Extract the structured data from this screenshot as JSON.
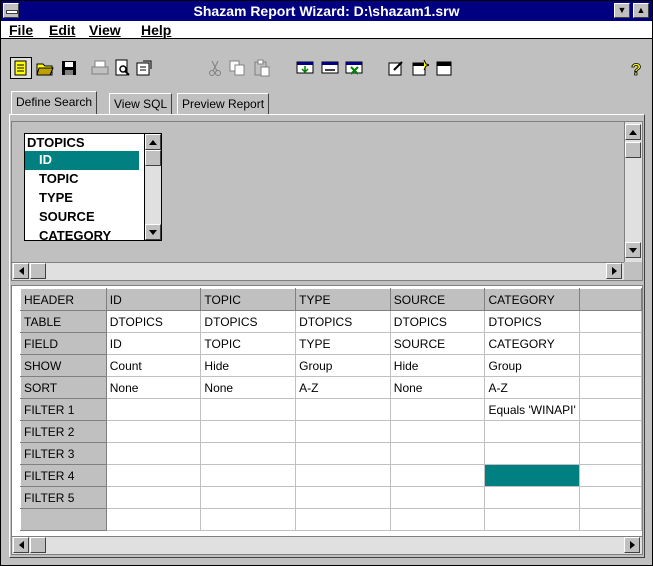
{
  "window": {
    "title": "Shazam Report Wizard: D:\\shazam1.srw"
  },
  "menu": [
    {
      "label": "File",
      "accel": "F"
    },
    {
      "label": "Edit",
      "accel": "E"
    },
    {
      "label": "View",
      "accel": "V"
    },
    {
      "label": "Help",
      "accel": "H"
    }
  ],
  "toolbar": {
    "icons": [
      "new-report-icon",
      "open-folder-icon",
      "save-icon",
      "print-icon",
      "print-preview-icon",
      "properties-icon",
      "cut-icon",
      "copy-icon",
      "paste-icon",
      "add-table-icon",
      "remove-table-icon",
      "delete-table-icon",
      "edit-icon",
      "insert-icon",
      "layout-icon",
      "help-icon"
    ]
  },
  "tabs": [
    {
      "label": "Define Search",
      "active": true
    },
    {
      "label": "View SQL",
      "active": false
    },
    {
      "label": "Preview Report",
      "active": false
    }
  ],
  "table_list": {
    "name": "DTOPICS",
    "fields": [
      "ID",
      "TOPIC",
      "TYPE",
      "SOURCE",
      "CATEGORY"
    ],
    "selected": "ID"
  },
  "grid": {
    "columns": [
      "HEADER",
      "ID",
      "TOPIC",
      "TYPE",
      "SOURCE",
      "CATEGORY",
      ""
    ],
    "rows": [
      {
        "label": "TABLE",
        "cells": [
          "DTOPICS",
          "DTOPICS",
          "DTOPICS",
          "DTOPICS",
          "DTOPICS",
          ""
        ]
      },
      {
        "label": "FIELD",
        "cells": [
          "ID",
          "TOPIC",
          "TYPE",
          "SOURCE",
          "CATEGORY",
          ""
        ]
      },
      {
        "label": "SHOW",
        "cells": [
          "Count",
          "Hide",
          "Group",
          "Hide",
          "Group",
          ""
        ]
      },
      {
        "label": "SORT",
        "cells": [
          "None",
          "None",
          "A-Z",
          "None",
          "A-Z",
          ""
        ]
      },
      {
        "label": "FILTER 1",
        "cells": [
          "",
          "",
          "",
          "",
          "Equals 'WINAPI'",
          ""
        ]
      },
      {
        "label": "FILTER 2",
        "cells": [
          "",
          "",
          "",
          "",
          "",
          ""
        ]
      },
      {
        "label": "FILTER 3",
        "cells": [
          "",
          "",
          "",
          "",
          "",
          ""
        ]
      },
      {
        "label": "FILTER 4",
        "cells": [
          "",
          "",
          "",
          "",
          "",
          ""
        ]
      },
      {
        "label": "FILTER 5",
        "cells": [
          "",
          "",
          "",
          "",
          "",
          ""
        ]
      },
      {
        "label": "",
        "cells": [
          "",
          "",
          "",
          "",
          "",
          ""
        ]
      }
    ],
    "selected_cell": {
      "row": 7,
      "col": 4
    }
  },
  "colors": {
    "titlebar": "#000080",
    "selection": "#008080",
    "face": "#c0c0c0"
  }
}
